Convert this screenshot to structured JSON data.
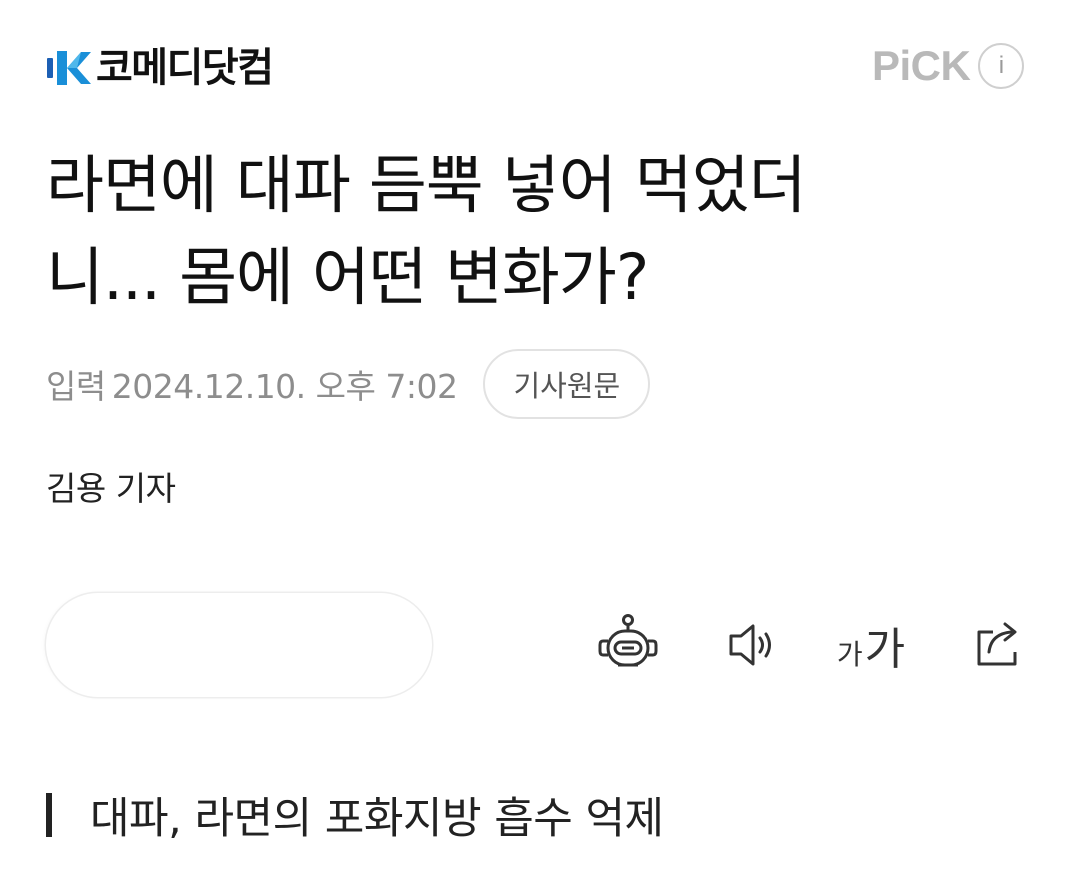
{
  "header": {
    "logo_text": "코메디닷컴",
    "logo_icon": "k-logo-icon",
    "pick_label": "PiCK",
    "info_label": "i"
  },
  "article": {
    "headline_line1": "라면에 대파 듬뿍 넣어 먹었더",
    "headline_line2": "니... 몸에 어떤 변화가?",
    "date_label": "입력",
    "date_value": "2024.12.10. 오후 7:02",
    "source_button": "기사원문",
    "reporter": "김용 기자",
    "subheading": "대파, 라면의 포화지방 흡수 억제"
  },
  "toolbar": {
    "icons": [
      "robot-summary-icon",
      "speaker-icon",
      "font-size-icon",
      "share-icon"
    ],
    "font_small": "가",
    "font_big": "가"
  },
  "colors": {
    "logo_blue": "#1a8fd8",
    "logo_dark_blue": "#1c5fb4",
    "muted_text": "#8d8d8d",
    "pick_gray": "#b9b9b9"
  }
}
